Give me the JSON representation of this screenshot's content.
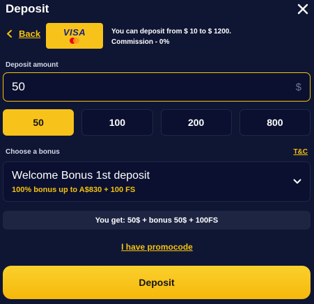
{
  "header": {
    "title": "Deposit"
  },
  "back": {
    "label": "Back"
  },
  "payment_method": {
    "brand": "VISA"
  },
  "deposit_info": {
    "line1": "You can deposit from $ 10 to $ 1200.",
    "line2": "Commission - 0%"
  },
  "amount": {
    "label": "Deposit amount",
    "value": "50",
    "currency": "$"
  },
  "presets": [
    {
      "label": "50",
      "selected": true
    },
    {
      "label": "100",
      "selected": false
    },
    {
      "label": "200",
      "selected": false
    },
    {
      "label": "800",
      "selected": false
    }
  ],
  "bonus": {
    "label": "Choose a bonus",
    "tc_link": "T&C",
    "selected_title": "Welcome Bonus 1st deposit",
    "selected_subtitle": "100% bonus up to A$830 + 100 FS"
  },
  "summary": {
    "text": "You get: 50$ + bonus 50$ + 100FS"
  },
  "promo": {
    "label": "I have promocode"
  },
  "deposit_button": {
    "label": "Deposit"
  },
  "colors": {
    "background": "#0f1634",
    "accent": "#f7c31a",
    "field": "#0b1030"
  }
}
